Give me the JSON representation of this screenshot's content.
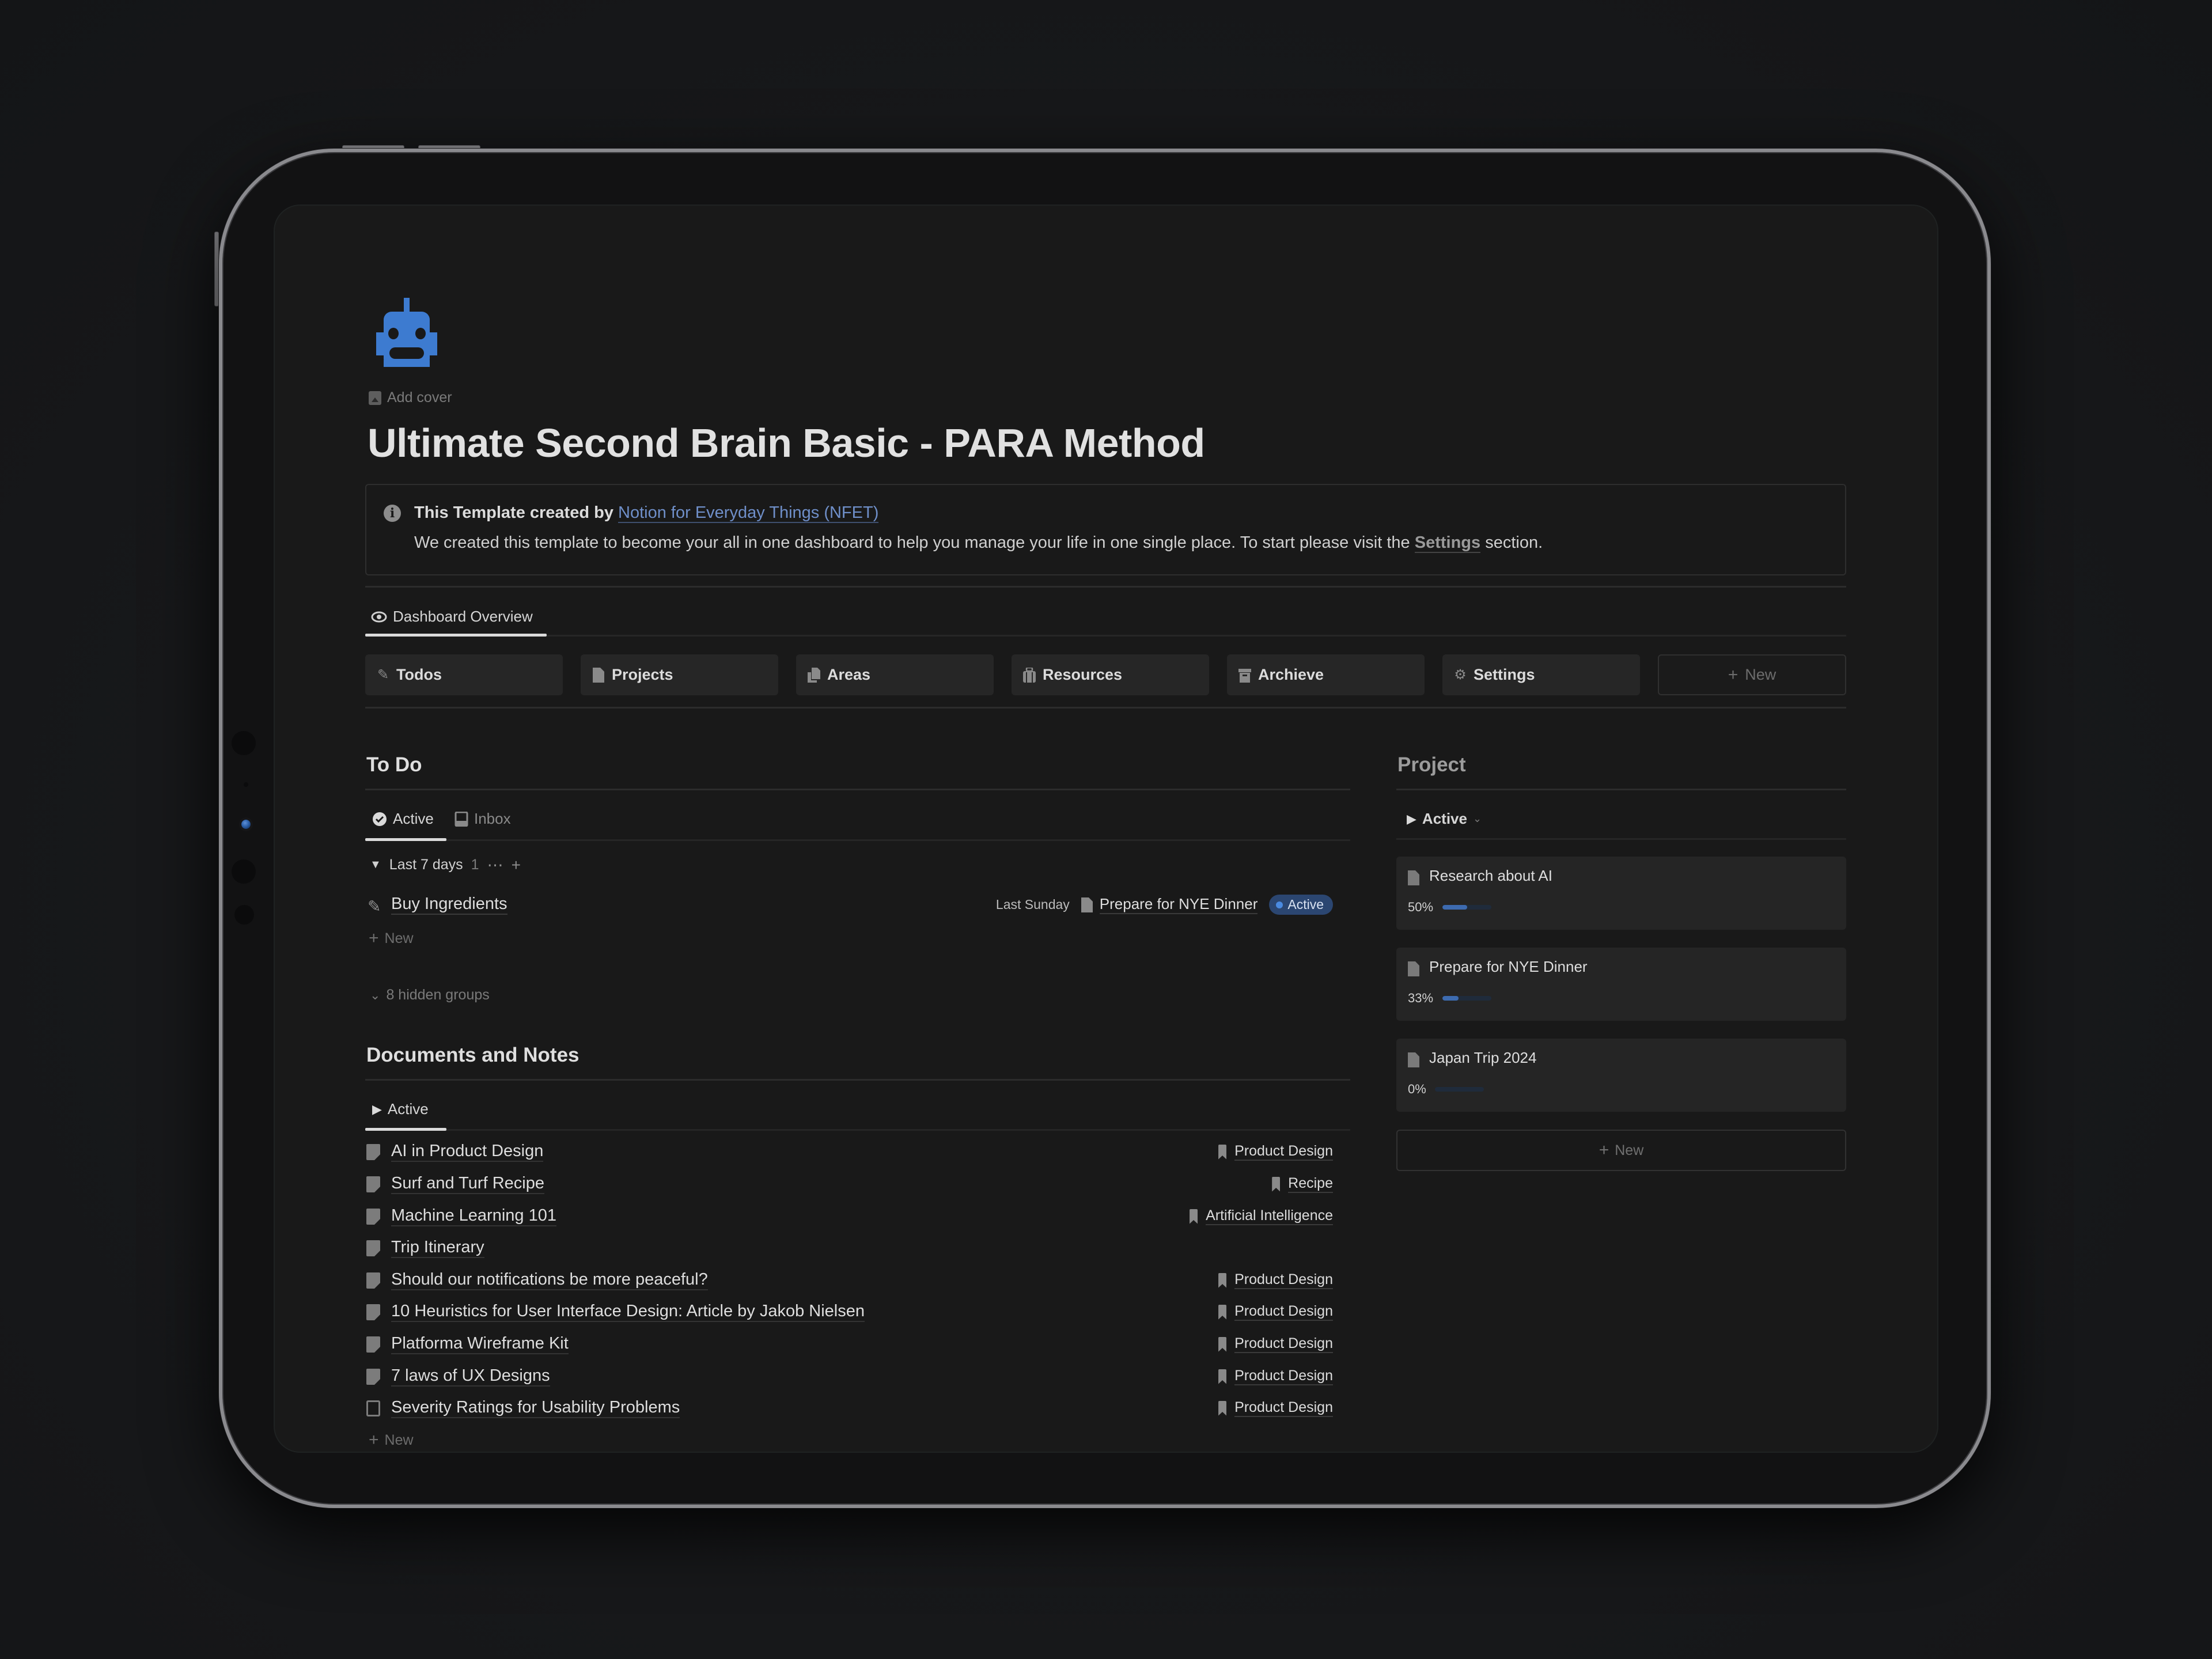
{
  "page": {
    "icon": "robot-icon",
    "add_cover_label": "Add cover",
    "title": "Ultimate Second Brain Basic - PARA Method"
  },
  "callout": {
    "icon": "info-icon",
    "prefix": "This Template created by ",
    "link_text": "Notion for Everyday Things (NFET)",
    "body_before": "We created this template to become your all in one dashboard to help you manage your life in one single place. To start please visit the ",
    "body_link": "Settings",
    "body_after": " section."
  },
  "view_tabs": [
    {
      "label": "Dashboard Overview",
      "icon": "eye-icon",
      "active": true
    }
  ],
  "nav_buttons": [
    {
      "label": "Todos",
      "icon": "pencil-icon"
    },
    {
      "label": "Projects",
      "icon": "document-icon"
    },
    {
      "label": "Areas",
      "icon": "documents-stack-icon"
    },
    {
      "label": "Resources",
      "icon": "briefcase-icon"
    },
    {
      "label": "Archieve",
      "icon": "archive-icon"
    },
    {
      "label": "Settings",
      "icon": "gears-icon"
    },
    {
      "label": "New",
      "icon": "plus-icon"
    }
  ],
  "todo": {
    "heading": "To Do",
    "tabs": [
      {
        "label": "Active",
        "icon": "check-circle-icon",
        "active": true
      },
      {
        "label": "Inbox",
        "icon": "inbox-icon",
        "active": false
      }
    ],
    "group": {
      "label": "Last 7 days",
      "count": "1"
    },
    "items": [
      {
        "name": "Buy Ingredients",
        "date": "Last Sunday",
        "project": "Prepare for NYE Dinner",
        "status": "Active"
      }
    ],
    "new_label": "New",
    "hidden_groups_label": "8 hidden groups"
  },
  "docs": {
    "heading": "Documents and Notes",
    "tabs": [
      {
        "label": "Active",
        "icon": "play-icon",
        "active": true
      }
    ],
    "items": [
      {
        "name": "AI in Product Design",
        "tag": "Product Design",
        "icon": "note-icon"
      },
      {
        "name": "Surf and Turf Recipe",
        "tag": "Recipe",
        "icon": "note-icon"
      },
      {
        "name": "Machine Learning 101",
        "tag": "Artificial Intelligence",
        "icon": "note-icon"
      },
      {
        "name": "Trip Itinerary",
        "tag": "",
        "icon": "note-icon"
      },
      {
        "name": "Should our notifications be more peaceful?",
        "tag": "Product Design",
        "icon": "note-icon"
      },
      {
        "name": "10 Heuristics for User Interface Design: Article by Jakob Nielsen",
        "tag": "Product Design",
        "icon": "note-icon"
      },
      {
        "name": "Platforma Wireframe Kit",
        "tag": "Product Design",
        "icon": "note-icon"
      },
      {
        "name": "7 laws of UX Designs",
        "tag": "Product Design",
        "icon": "note-icon"
      },
      {
        "name": "Severity Ratings for Usability Problems",
        "tag": "Product Design",
        "icon": "file-text-icon"
      }
    ],
    "new_label": "New"
  },
  "projects": {
    "heading": "Project",
    "view_label": "Active",
    "items": [
      {
        "name": "Research about AI",
        "progress_label": "50%",
        "progress": 0.5
      },
      {
        "name": "Prepare for NYE Dinner",
        "progress_label": "33%",
        "progress": 0.33
      },
      {
        "name": "Japan Trip 2024",
        "progress_label": "0%",
        "progress": 0
      }
    ],
    "new_label": "New"
  },
  "colors": {
    "accent_blue": "#3d7bd0",
    "link_blue": "#6f8fc9",
    "badge_bg": "#2b4671",
    "badge_dot": "#4a8ae0",
    "progress_fill": "#3d6bb0",
    "background": "#191919"
  }
}
